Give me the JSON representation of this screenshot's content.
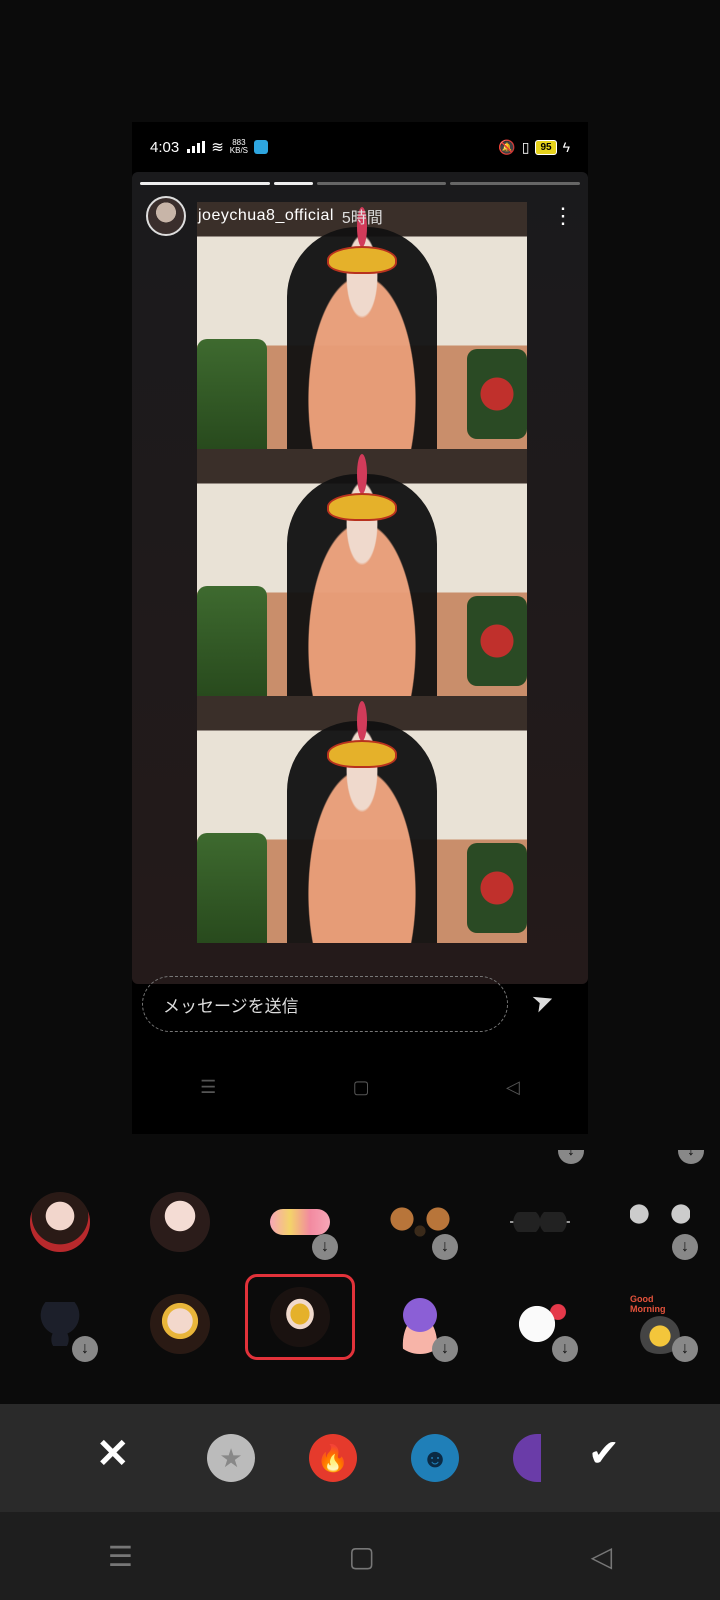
{
  "status_bar": {
    "time": "4:03",
    "net_speed_value": "883",
    "net_speed_unit": "KB/S",
    "battery": "95"
  },
  "story": {
    "username": "joeychua8_official",
    "time_ago": "5時間",
    "progress_segments": 4,
    "progress_done": 1
  },
  "message_bar": {
    "placeholder": "メッセージを送信"
  },
  "stickers": {
    "row1": [
      "princess-gold-crown",
      "girl-purple-hair",
      "flower-crown",
      "puppy-ears",
      "sunglasses",
      "cat-ears"
    ],
    "row2": [
      "black-hat-bowtie",
      "veil-princess",
      "masquerade-mask-feather",
      "purple-monster-egg",
      "white-bunny-heart",
      "good-morning-frypan"
    ],
    "selected": "masquerade-mask-feather",
    "good_morning_text": "Good Morning"
  },
  "filters": [
    "star-filter",
    "flame-filter",
    "blue-face-filter",
    "purple-filter"
  ],
  "colors": {
    "accent": "#e2323a",
    "tray_bg": "#0b0b0b",
    "filterbar_bg": "#2a2a2a"
  }
}
